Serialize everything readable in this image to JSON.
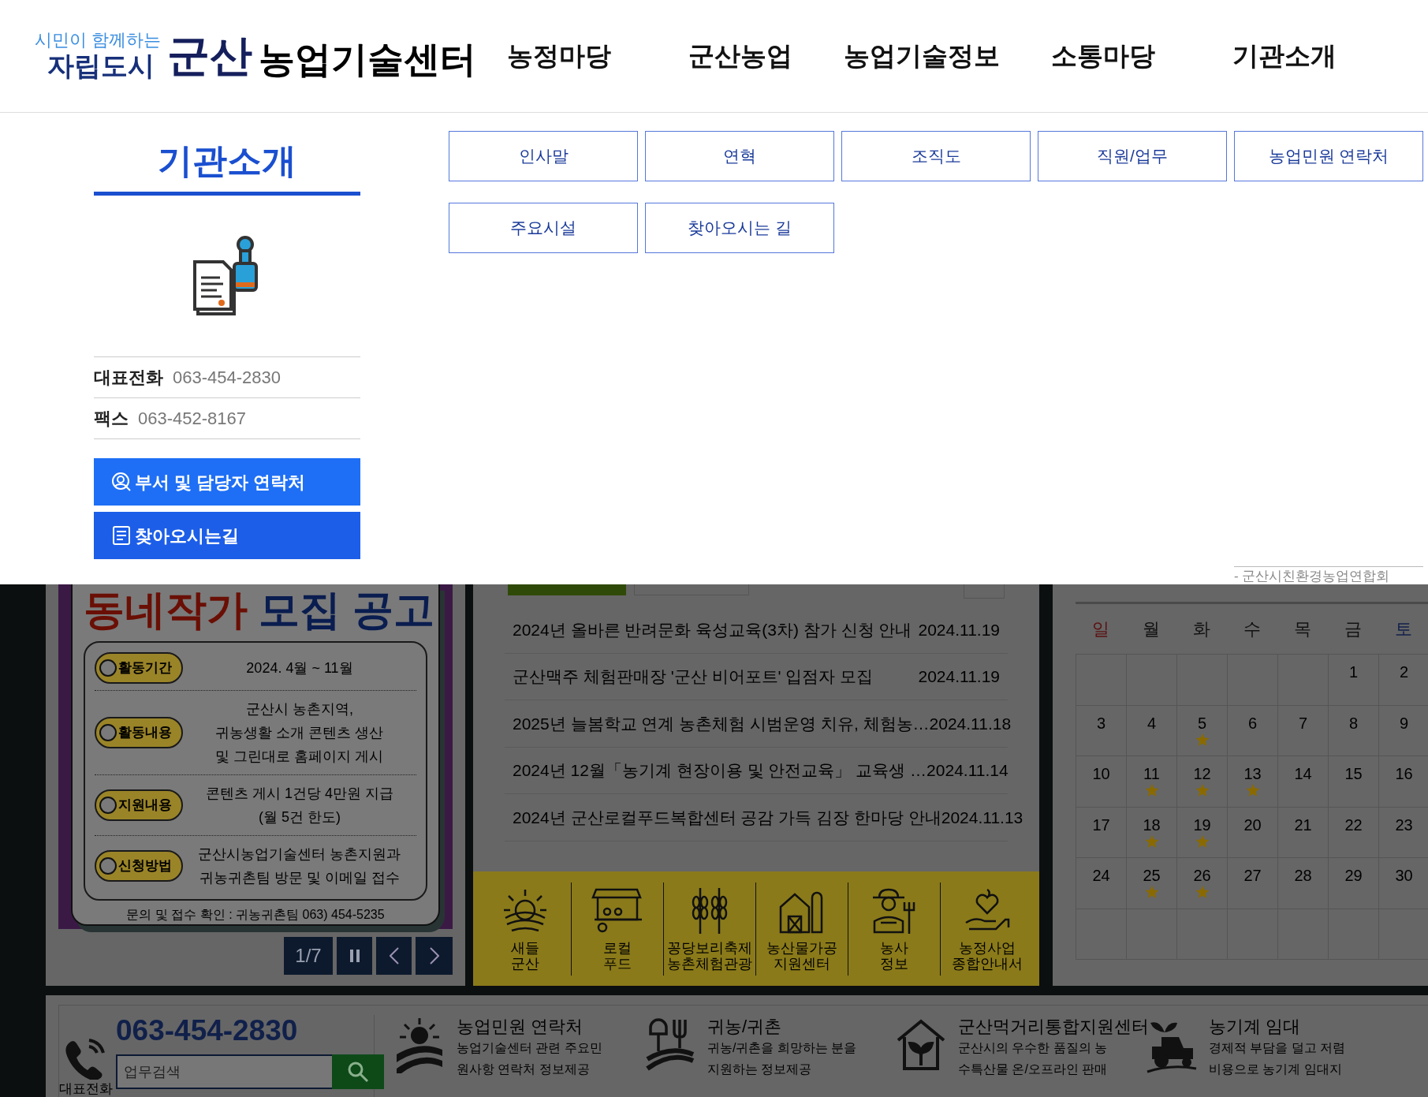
{
  "header": {
    "logo": {
      "tagline": "시민이 함께하는",
      "city": "자립도시",
      "brand": "군산",
      "title": "농업기술센터"
    },
    "nav": [
      "농정마당",
      "군산농업",
      "농업기술정보",
      "소통마당",
      "기관소개"
    ]
  },
  "mega_menu": {
    "title": "기관소개",
    "contacts": [
      {
        "label": "대표전화",
        "value": "063-454-2830"
      },
      {
        "label": "팩스",
        "value": "063-452-8167"
      }
    ],
    "buttons": [
      {
        "label": "부서 및 담당자 연락처",
        "kind": "person"
      },
      {
        "label": "찾아오시는길",
        "kind": "document"
      }
    ],
    "links": [
      "인사말",
      "연혁",
      "조직도",
      "직원/업무",
      "농업민원 연락처",
      "주요시설",
      "찾아오시는 길"
    ],
    "side_note": "- 군산시친환경농업연합회"
  },
  "banner": {
    "headline": "동네작가",
    "headline_accent": "모집 공고",
    "rows": [
      {
        "tag": "활동기간",
        "lines": [
          "2024. 4월 ~ 11월"
        ]
      },
      {
        "tag": "활동내용",
        "lines": [
          "군산시 농촌지역,",
          "귀농생활 소개 콘텐츠 생산",
          "및 그린대로 홈페이지 게시"
        ]
      },
      {
        "tag": "지원내용",
        "lines": [
          "콘텐츠 게시 1건당 4만원 지급",
          "(월 5건 한도)"
        ]
      },
      {
        "tag": "신청방법",
        "lines": [
          "군산시농업기술센터 농촌지원과",
          "귀농귀촌팀 방문 및 이메일 접수"
        ]
      }
    ],
    "footer": "문의 및 접수 확인 : 귀농귀촌팀 063) 454-5235",
    "counter": "1/7"
  },
  "notices": [
    {
      "title": "2024년 올바른 반려문화 육성교육(3차) 참가 신청 안내",
      "date": "2024.11.19"
    },
    {
      "title": "군산맥주 체험판매장 '군산 비어포트' 입점자 모집",
      "date": "2024.11.19"
    },
    {
      "title": "2025년 늘봄학교 연계 농촌체험 시범운영 치유, 체험농…",
      "date": "2024.11.18"
    },
    {
      "title": "2024년 12월「농기계 현장이용 및 안전교육」 교육생 …",
      "date": "2024.11.14"
    },
    {
      "title": "2024년 군산로컬푸드복합센터 공감 가득 김장 한마당 안내",
      "date": "2024.11.13"
    }
  ],
  "quick_links": [
    {
      "kind": "sun",
      "lines": [
        "새들",
        "군산"
      ]
    },
    {
      "kind": "market",
      "lines": [
        "로컬",
        "푸드"
      ]
    },
    {
      "kind": "wheat",
      "lines": [
        "꽁당보리축제",
        "농촌체험관광"
      ]
    },
    {
      "kind": "barn",
      "lines": [
        "농산물가공",
        "지원센터"
      ]
    },
    {
      "kind": "farmer",
      "lines": [
        "농사",
        "정보"
      ]
    },
    {
      "kind": "heart",
      "lines": [
        "농정사업",
        "종합안내서"
      ]
    }
  ],
  "calendar": {
    "weekdays": [
      {
        "label": "일",
        "color": "#5c1010"
      },
      {
        "label": "월",
        "color": "#111111"
      },
      {
        "label": "화",
        "color": "#111111"
      },
      {
        "label": "수",
        "color": "#111111"
      },
      {
        "label": "목",
        "color": "#111111"
      },
      {
        "label": "금",
        "color": "#111111"
      },
      {
        "label": "토",
        "color": "#0f1f4a"
      }
    ],
    "weeks": [
      [
        {
          "kind": "blank"
        },
        {
          "kind": "blank"
        },
        {
          "kind": "blank"
        },
        {
          "kind": "blank"
        },
        {
          "kind": "blank"
        },
        {
          "kind": "day",
          "day": "1",
          "event": false
        },
        {
          "kind": "day",
          "day": "2",
          "event": false
        }
      ],
      [
        {
          "kind": "day",
          "day": "3",
          "event": false
        },
        {
          "kind": "day",
          "day": "4",
          "event": false
        },
        {
          "kind": "day",
          "day": "5",
          "event": true
        },
        {
          "kind": "day",
          "day": "6",
          "event": false
        },
        {
          "kind": "day",
          "day": "7",
          "event": false
        },
        {
          "kind": "day",
          "day": "8",
          "event": false
        },
        {
          "kind": "day",
          "day": "9",
          "event": false
        }
      ],
      [
        {
          "kind": "day",
          "day": "10",
          "event": false
        },
        {
          "kind": "day",
          "day": "11",
          "event": true
        },
        {
          "kind": "day",
          "day": "12",
          "event": true
        },
        {
          "kind": "day",
          "day": "13",
          "event": true
        },
        {
          "kind": "day",
          "day": "14",
          "event": false
        },
        {
          "kind": "day",
          "day": "15",
          "event": false
        },
        {
          "kind": "day",
          "day": "16",
          "event": false
        }
      ],
      [
        {
          "kind": "day",
          "day": "17",
          "event": false
        },
        {
          "kind": "day",
          "day": "18",
          "event": true
        },
        {
          "kind": "day",
          "day": "19",
          "event": true
        },
        {
          "kind": "day",
          "day": "20",
          "event": false
        },
        {
          "kind": "day",
          "day": "21",
          "event": false
        },
        {
          "kind": "day",
          "day": "22",
          "event": false
        },
        {
          "kind": "day",
          "day": "23",
          "event": false
        }
      ],
      [
        {
          "kind": "day",
          "day": "24",
          "event": false
        },
        {
          "kind": "day",
          "day": "25",
          "event": true
        },
        {
          "kind": "day",
          "day": "26",
          "event": true
        },
        {
          "kind": "day",
          "day": "27",
          "event": false
        },
        {
          "kind": "day",
          "day": "28",
          "event": false
        },
        {
          "kind": "day",
          "day": "29",
          "event": false
        },
        {
          "kind": "day",
          "day": "30",
          "event": false
        }
      ],
      [
        {
          "kind": "blank"
        },
        {
          "kind": "blank"
        },
        {
          "kind": "blank"
        },
        {
          "kind": "blank"
        },
        {
          "kind": "blank"
        },
        {
          "kind": "blank"
        },
        {
          "kind": "blank"
        }
      ]
    ]
  },
  "footer": {
    "phone": "063-454-2830",
    "phone_label": "대표전화",
    "search": {
      "placeholder": "업무검색"
    },
    "services": [
      {
        "kind": "sun",
        "title": "농업민원 연락처",
        "lines": [
          "농업기술센터 관련 주요민",
          "원사항 연락처 정보제공"
        ]
      },
      {
        "kind": "tools",
        "title": "귀농/귀촌",
        "lines": [
          "귀농/귀촌을 희망하는 분을",
          "지원하는 정보제공"
        ]
      },
      {
        "kind": "house",
        "title": "군산먹거리통합지원센터",
        "lines": [
          "군산시의 우수한 품질의 농",
          "수특산물 온/오프라인 판매"
        ]
      },
      {
        "kind": "tractor",
        "title": "농기계 임대",
        "lines": [
          "경제적 부담을 덜고 저렴",
          "비용으로 농기계 임대지"
        ]
      }
    ]
  }
}
